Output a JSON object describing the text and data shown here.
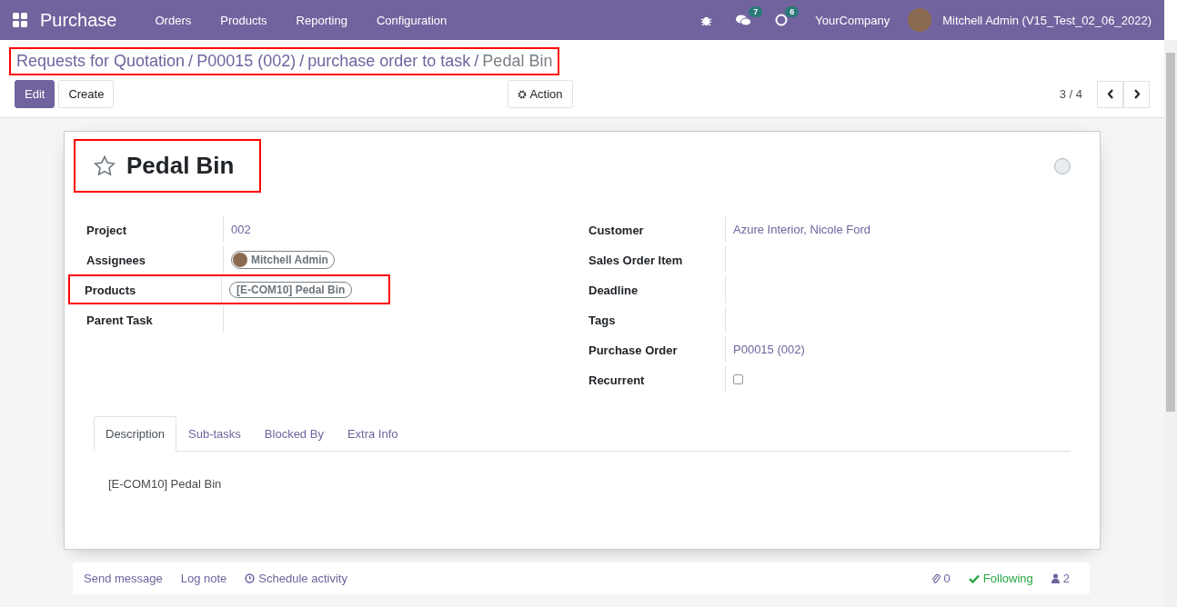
{
  "navbar": {
    "app_name": "Purchase",
    "menu": [
      "Orders",
      "Products",
      "Reporting",
      "Configuration"
    ],
    "messages_badge": "7",
    "activities_badge": "6",
    "company": "YourCompany",
    "user": "Mitchell Admin (V15_Test_02_06_2022)"
  },
  "breadcrumb": {
    "highlighted": true,
    "separator": "/",
    "items": [
      "Requests for Quotation",
      "P00015 (002)",
      "purchase order to task",
      "Pedal Bin"
    ]
  },
  "buttons": {
    "edit": "Edit",
    "create": "Create",
    "action": "Action"
  },
  "pager": {
    "value": "3 / 4"
  },
  "task": {
    "title": "Pedal Bin",
    "starred": false,
    "title_highlighted": true,
    "left_fields": [
      {
        "label": "Project",
        "kind": "link",
        "value": "002",
        "highlighted": false
      },
      {
        "label": "Assignees",
        "kind": "user_tag",
        "value": "Mitchell Admin",
        "highlighted": false
      },
      {
        "label": "Products",
        "kind": "tag",
        "value": "[E-COM10] Pedal Bin",
        "highlighted": true
      },
      {
        "label": "Parent Task",
        "kind": "empty",
        "highlighted": false
      }
    ],
    "right_fields": [
      {
        "label": "Customer",
        "kind": "link",
        "value": "Azure Interior, Nicole Ford"
      },
      {
        "label": "Sales Order Item",
        "kind": "empty"
      },
      {
        "label": "Deadline",
        "kind": "empty"
      },
      {
        "label": "Tags",
        "kind": "empty"
      },
      {
        "label": "Purchase Order",
        "kind": "link",
        "value": "P00015 (002)"
      },
      {
        "label": "Recurrent",
        "kind": "checkbox",
        "checked": false
      }
    ],
    "tabs": [
      {
        "label": "Description",
        "selected": true
      },
      {
        "label": "Sub-tasks",
        "selected": false
      },
      {
        "label": "Blocked By",
        "selected": false
      },
      {
        "label": "Extra Info",
        "selected": false
      }
    ],
    "description": "[E-COM10] Pedal Bin"
  },
  "chatter": {
    "send_message": "Send message",
    "log_note": "Log note",
    "schedule_activity": "Schedule activity",
    "attachments": "0",
    "follow": "Following",
    "followers": "2"
  }
}
